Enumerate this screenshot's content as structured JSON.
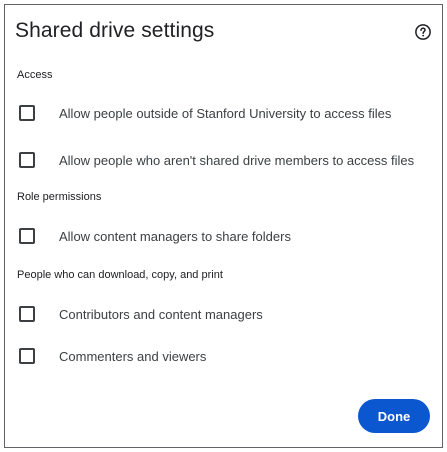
{
  "dialog": {
    "title": "Shared drive settings",
    "help_icon": "help-circle-icon",
    "done_label": "Done",
    "accent_color": "#0b57d0"
  },
  "sections": [
    {
      "label": "Access",
      "options": [
        {
          "label": "Allow people outside of Stanford University to access files",
          "checked": false
        },
        {
          "label": "Allow people who aren't shared drive members to access files",
          "checked": false
        }
      ]
    },
    {
      "label": "Role permissions",
      "options": [
        {
          "label": "Allow content managers to share folders",
          "checked": false
        }
      ]
    },
    {
      "label": "People who can download, copy, and print",
      "options": [
        {
          "label": "Contributors and content managers",
          "checked": false
        },
        {
          "label": "Commenters and viewers",
          "checked": false
        }
      ]
    }
  ]
}
